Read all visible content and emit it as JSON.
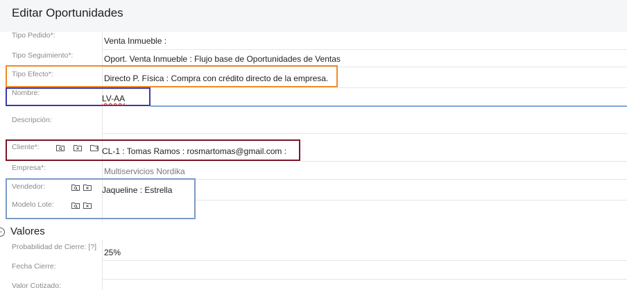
{
  "header": {
    "title": "Editar Oportunidades"
  },
  "fields": {
    "tipo_pedido": {
      "label": "Tipo Pedido*:",
      "value": "Venta Inmueble :"
    },
    "tipo_seguimiento": {
      "label": "Tipo Seguimiento*:",
      "value": "Oport. Venta Inmueble : Flujo base de Oportunidades de Ventas"
    },
    "tipo_efecto": {
      "label": "Tipo Efecto*:",
      "value": "Directo P. Física : Compra con crédito directo de la empresa."
    },
    "nombre": {
      "label": "Nombre:",
      "value": "LV-AA"
    },
    "descripcion": {
      "label": "Descripción:",
      "value": ""
    },
    "cliente": {
      "label": "Cliente*:",
      "value": "CL-1  :  Tomas Ramos   :  rosmartomas@gmail.com  :"
    },
    "empresa": {
      "label": "Empresa*:",
      "value": "Multiservicios Nordika"
    },
    "vendedor": {
      "label": "Vendedor:",
      "value": "Jaqueline  :  Estrella"
    },
    "modelo_lote": {
      "label": "Modelo Lote:",
      "value": ""
    }
  },
  "section_valores": {
    "title": "Valores",
    "probabilidad": {
      "label": "Probabilidad de Cierre: [?]",
      "value": "25%"
    },
    "fecha_cierre": {
      "label": "Fecha Cierre:",
      "value": ""
    },
    "valor_cotizado": {
      "label": "Valor Cotizado:",
      "value": ""
    }
  },
  "icons": {
    "search": "search-folder-icon",
    "clear": "clear-folder-icon",
    "open": "open-folder-icon"
  },
  "colors": {
    "orange_box": "#f08a24",
    "navy_box": "#3a3aa8",
    "maroon_box": "#7a1526",
    "steel_box": "#7a9cc6",
    "light_blue_line": "#7fa7d8"
  }
}
